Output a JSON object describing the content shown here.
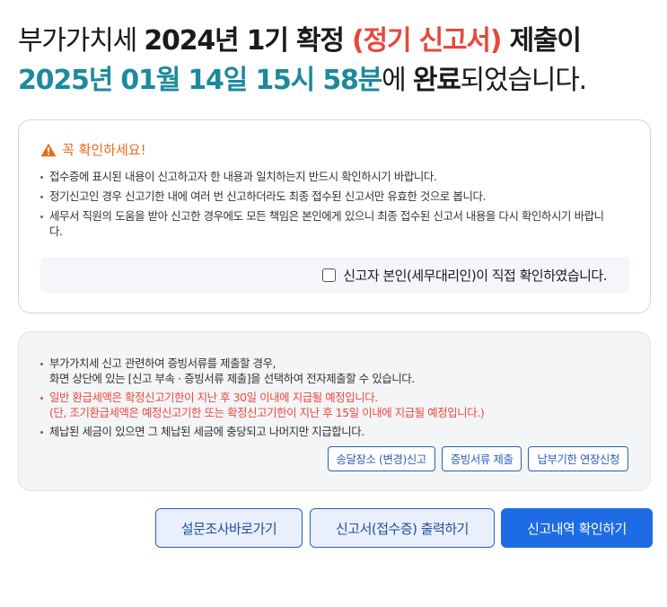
{
  "headline": {
    "line1": {
      "prefix": "부가가치세 ",
      "period": "2024년 1기 확정 ",
      "report_type": "(정기 신고서)",
      "suffix": " 제출이"
    },
    "line2": {
      "datetime": "2025년 01월 14일 15시 58분",
      "mid": "에 ",
      "status": "완료",
      "end": "되었습니다."
    }
  },
  "notice": {
    "title": "꼭 확인하세요!",
    "icon": "warning-icon",
    "items": [
      "접수증에 표시된 내용이 신고하고자 한 내용과 일치하는지 반드시 확인하시기 바랍니다.",
      "정기신고인 경우 신고기한 내에 여러 번 신고하더라도 최종 접수된 신고서만 유효한 것으로 봅니다.",
      "세무서 직원의 도움을 받아 신고한 경우에도 모든 책임은 본인에게 있으니 최종 접수된 신고서 내용을 다시 확인하시기 바랍니다."
    ],
    "confirm_label": "신고자 본인(세무대리인)이 직접 확인하였습니다."
  },
  "info": {
    "items": [
      {
        "line1": "부가가치세 신고 관련하여 증빙서류를 제출할 경우,",
        "line2": "화면 상단에 있는 [신고 부속 · 증빙서류 제출]을 선택하여 전자제출할 수 있습니다."
      },
      {
        "line1": "일반 환급세액은 확정신고기한이 지난 후 30일 이내에 지급될 예정입니다.",
        "line2": "(단, 조기환급세액은 예정신고기한 또는 확정신고기한이 지난 후 15일 이내에 지급될 예정입니다.)"
      },
      {
        "line1": "체납된 세금이 있으면 그 체납된 세금에 충당되고 나머지만 지급합니다.",
        "line2": ""
      }
    ],
    "buttons": {
      "delivery": "송달장소 (변경)신고",
      "evidence": "증빙서류 제출",
      "extension": "납부기한 연장신청"
    }
  },
  "actions": {
    "survey": "설문조사바로가기",
    "print": "신고서(접수증) 출력하기",
    "view": "신고내역 확인하기"
  },
  "colors": {
    "accent_red": "#e8483c",
    "accent_teal": "#1b8a9c",
    "primary_blue": "#1e6be6",
    "warning_orange": "#e86a1a"
  }
}
